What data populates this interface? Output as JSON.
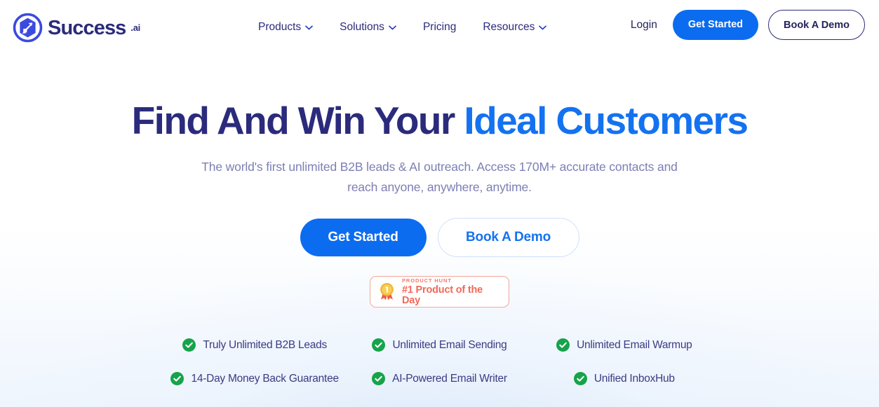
{
  "brand": {
    "name": "Success",
    "suffix": ".ai",
    "logo_icon": "rocket-hexagon-icon"
  },
  "nav": {
    "items": [
      {
        "label": "Products",
        "has_dropdown": true
      },
      {
        "label": "Solutions",
        "has_dropdown": true
      },
      {
        "label": "Pricing",
        "has_dropdown": false
      },
      {
        "label": "Resources",
        "has_dropdown": true
      }
    ]
  },
  "header_actions": {
    "login_label": "Login",
    "get_started_label": "Get Started",
    "book_demo_label": "Book A Demo"
  },
  "hero": {
    "headline_part1": "Find And Win Your ",
    "headline_accent": "Ideal Customers",
    "subhead_line1": "The world's first unlimited B2B leads & AI outreach. Access 170M+ accurate contacts",
    "subhead_line2": "and reach anyone, anywhere, anytime.",
    "cta_primary": "Get Started",
    "cta_secondary": "Book A Demo"
  },
  "product_hunt_badge": {
    "kicker": "PRODUCT HUNT",
    "title": "#1 Product of the Day",
    "medal_icon": "medal-first-place-icon"
  },
  "features": [
    {
      "label": "Truly Unlimited B2B Leads",
      "icon": "check-circle-icon"
    },
    {
      "label": "Unlimited Email Sending",
      "icon": "check-circle-icon"
    },
    {
      "label": "Unlimited Email Warmup",
      "icon": "check-circle-icon"
    },
    {
      "label": "14-Day Money Back Guarantee",
      "icon": "check-circle-icon"
    },
    {
      "label": "AI-Powered Email Writer",
      "icon": "check-circle-icon"
    },
    {
      "label": "Unified InboxHub",
      "icon": "check-circle-icon"
    }
  ],
  "colors": {
    "brand_navy": "#2b2b7c",
    "accent_blue": "#1472f0",
    "button_blue": "#0b6cf0",
    "subhead_gray": "#7d7fb3",
    "check_green": "#16a34a",
    "badge_orange": "#f2685a",
    "medal_gold": "#f5c344"
  }
}
